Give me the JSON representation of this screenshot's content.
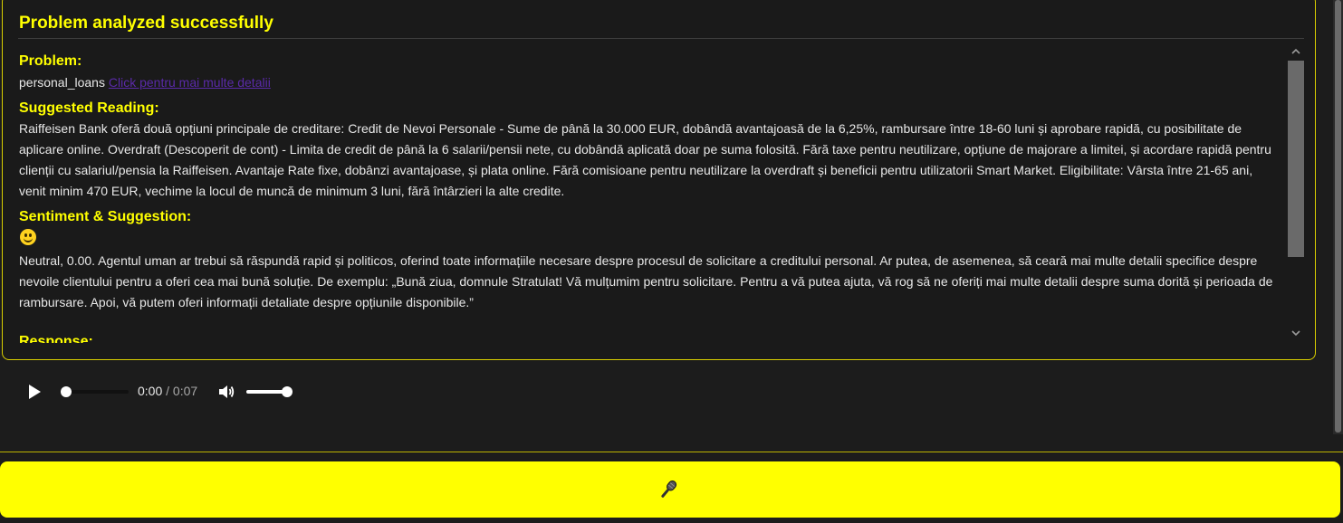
{
  "panel": {
    "title": "Problem analyzed successfully",
    "sections": {
      "problem_heading": "Problem:",
      "problem_value": "personal_loans",
      "problem_link": "Click pentru mai multe detalii",
      "reading_heading": "Suggested Reading:",
      "reading_text": "Raiffeisen Bank oferă două opțiuni principale de creditare: Credit de Nevoi Personale - Sume de până la 30.000 EUR, dobândă avantajoasă de la 6,25%, rambursare între 18-60 luni și aprobare rapidă, cu posibilitate de aplicare online. Overdraft (Descoperit de cont) - Limita de credit de până la 6 salarii/pensii nete, cu dobândă aplicată doar pe suma folosită. Fără taxe pentru neutilizare, opțiune de majorare a limitei, și acordare rapidă pentru clienții cu salariul/pensia la Raiffeisen. Avantaje Rate fixe, dobânzi avantajoase, și plata online. Fără comisioane pentru neutilizare la overdraft și beneficii pentru utilizatorii Smart Market. Eligibilitate: Vârsta între 21-65 ani, venit minim 470 EUR, vechime la locul de muncă de minimum 3 luni, fără întârzieri la alte credite.",
      "sentiment_heading": "Sentiment & Suggestion:",
      "sentiment_icon": "slightly-smiling-face-icon",
      "sentiment_text": "Neutral, 0.00. Agentul uman ar trebui să răspundă rapid și politicos, oferind toate informațiile necesare despre procesul de solicitare a creditului personal. Ar putea, de asemenea, să ceară mai multe detalii specifice despre nevoile clientului pentru a oferi cea mai bună soluție. De exemplu: „Bună ziua, domnule Stratulat! Vă mulțumim pentru solicitare. Pentru a vă putea ajuta, vă rog să ne oferiți mai multe detalii despre suma dorită și perioada de rambursare. Apoi, vă putem oferi informații detaliate despre opțiunile disponibile.”",
      "response_heading": "Response:"
    }
  },
  "audio": {
    "current_time": "0:00",
    "separator": " / ",
    "duration": "0:07",
    "volume": 1.0,
    "progress": 0.0
  },
  "bottom": {
    "mic_icon": "microphone-icon"
  },
  "colors": {
    "accent": "#ffff00",
    "background": "#1c1c1c",
    "link": "#5a2aa8"
  }
}
